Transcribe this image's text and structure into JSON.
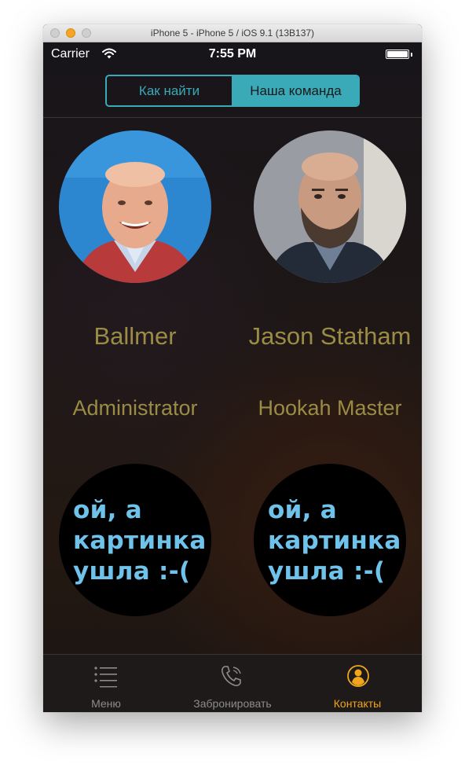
{
  "window": {
    "title": "iPhone 5 - iPhone 5 / iOS 9.1 (13B137)"
  },
  "status_bar": {
    "carrier": "Carrier",
    "time": "7:55 PM"
  },
  "segmented_control": {
    "segments": [
      {
        "label": "Как найти",
        "selected": false
      },
      {
        "label": "Наша команда",
        "selected": true
      }
    ],
    "accent_color": "#3aa9b8"
  },
  "team": [
    {
      "name": "Ballmer",
      "role": "Administrator",
      "photo": "photo"
    },
    {
      "name": "Jason Statham",
      "role": "Hookah Master",
      "photo": "photo"
    }
  ],
  "placeholders": [
    {
      "line1": "ой, а",
      "line2": "картинка",
      "line3": "ушла :-("
    },
    {
      "line1": "ой, а",
      "line2": "картинка",
      "line3": "ушла :-("
    }
  ],
  "tab_bar": {
    "items": [
      {
        "label": "Меню",
        "icon": "list-icon",
        "active": false
      },
      {
        "label": "Забронировать",
        "icon": "phone-icon",
        "active": false
      },
      {
        "label": "Контакты",
        "icon": "contact-icon",
        "active": true
      }
    ],
    "active_color": "#f0a51c"
  },
  "colors": {
    "text_gold": "#9a8c45",
    "placeholder_text": "#6fc3ea"
  }
}
